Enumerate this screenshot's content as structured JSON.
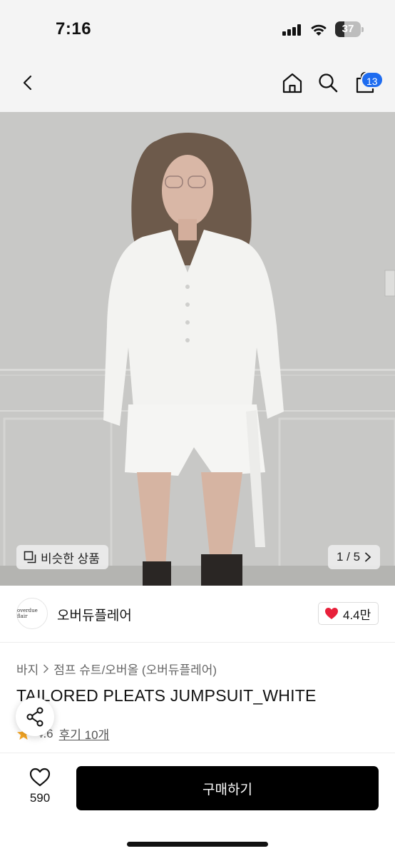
{
  "status_bar": {
    "time": "7:16",
    "battery": "37",
    "battery_level": 0.37
  },
  "header": {
    "back_icon": "chevron-left-icon",
    "home_icon": "home-icon",
    "search_icon": "search-icon",
    "cart_icon": "shopping-bag-icon",
    "cart_count": "13",
    "badge_color": "#1e6cf0"
  },
  "gallery": {
    "similar_label": "비슷한 상품",
    "page_indicator": "1 / 5",
    "image_subject": "model-wearing-white-jumpsuit"
  },
  "brand": {
    "logo_text": "overdue flair",
    "name": "오버듀플레어",
    "likes": "4.4만",
    "heart_color": "#e8203a"
  },
  "product": {
    "breadcrumb": [
      "바지",
      "점프 슈트/오버올 (오버듀플레어)"
    ],
    "title": "TAILORED PLEATS JUMPSUIT_WHITE",
    "rating": "4.6",
    "reviews": "후기 10개"
  },
  "bottom_bar": {
    "wishlist_count": "590",
    "buy_label": "구매하기",
    "buy_color": "#000000"
  }
}
